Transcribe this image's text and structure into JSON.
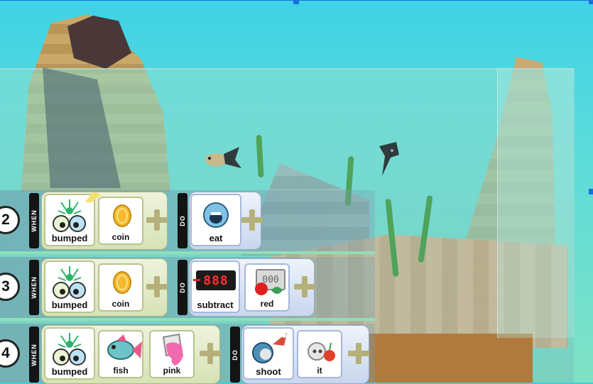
{
  "rows": [
    {
      "number": "2",
      "when_label": "WHEN",
      "do_label": "DO",
      "when_tiles": [
        "bumped",
        "coin"
      ],
      "do_tiles": [
        "eat"
      ]
    },
    {
      "number": "3",
      "when_label": "WHEN",
      "do_label": "DO",
      "when_tiles": [
        "bumped",
        "coin"
      ],
      "do_tiles": [
        "subtract",
        "red"
      ],
      "score_display": "888",
      "score_icon_text": "000"
    },
    {
      "number": "4",
      "when_label": "WHEN",
      "do_label": "DO",
      "when_tiles": [
        "bumped",
        "fish",
        "pink"
      ],
      "do_tiles": [
        "shoot",
        "it"
      ]
    }
  ],
  "icons": {
    "bumped": "bumped-sensor-icon",
    "coin": "coin-icon",
    "eat": "eat-mouth-icon",
    "subtract": "score-subtract-icon",
    "red": "red-score-icon",
    "fish": "fish-icon",
    "pink": "pink-paint-icon",
    "shoot": "shoot-missile-icon",
    "it": "it-target-icon",
    "add": "add-plus-icon"
  },
  "colors": {
    "selection": "#1a6fe0",
    "when_panel": "#d7e2b5",
    "do_panel": "#c8d6ee",
    "score_red": "#e02020"
  }
}
